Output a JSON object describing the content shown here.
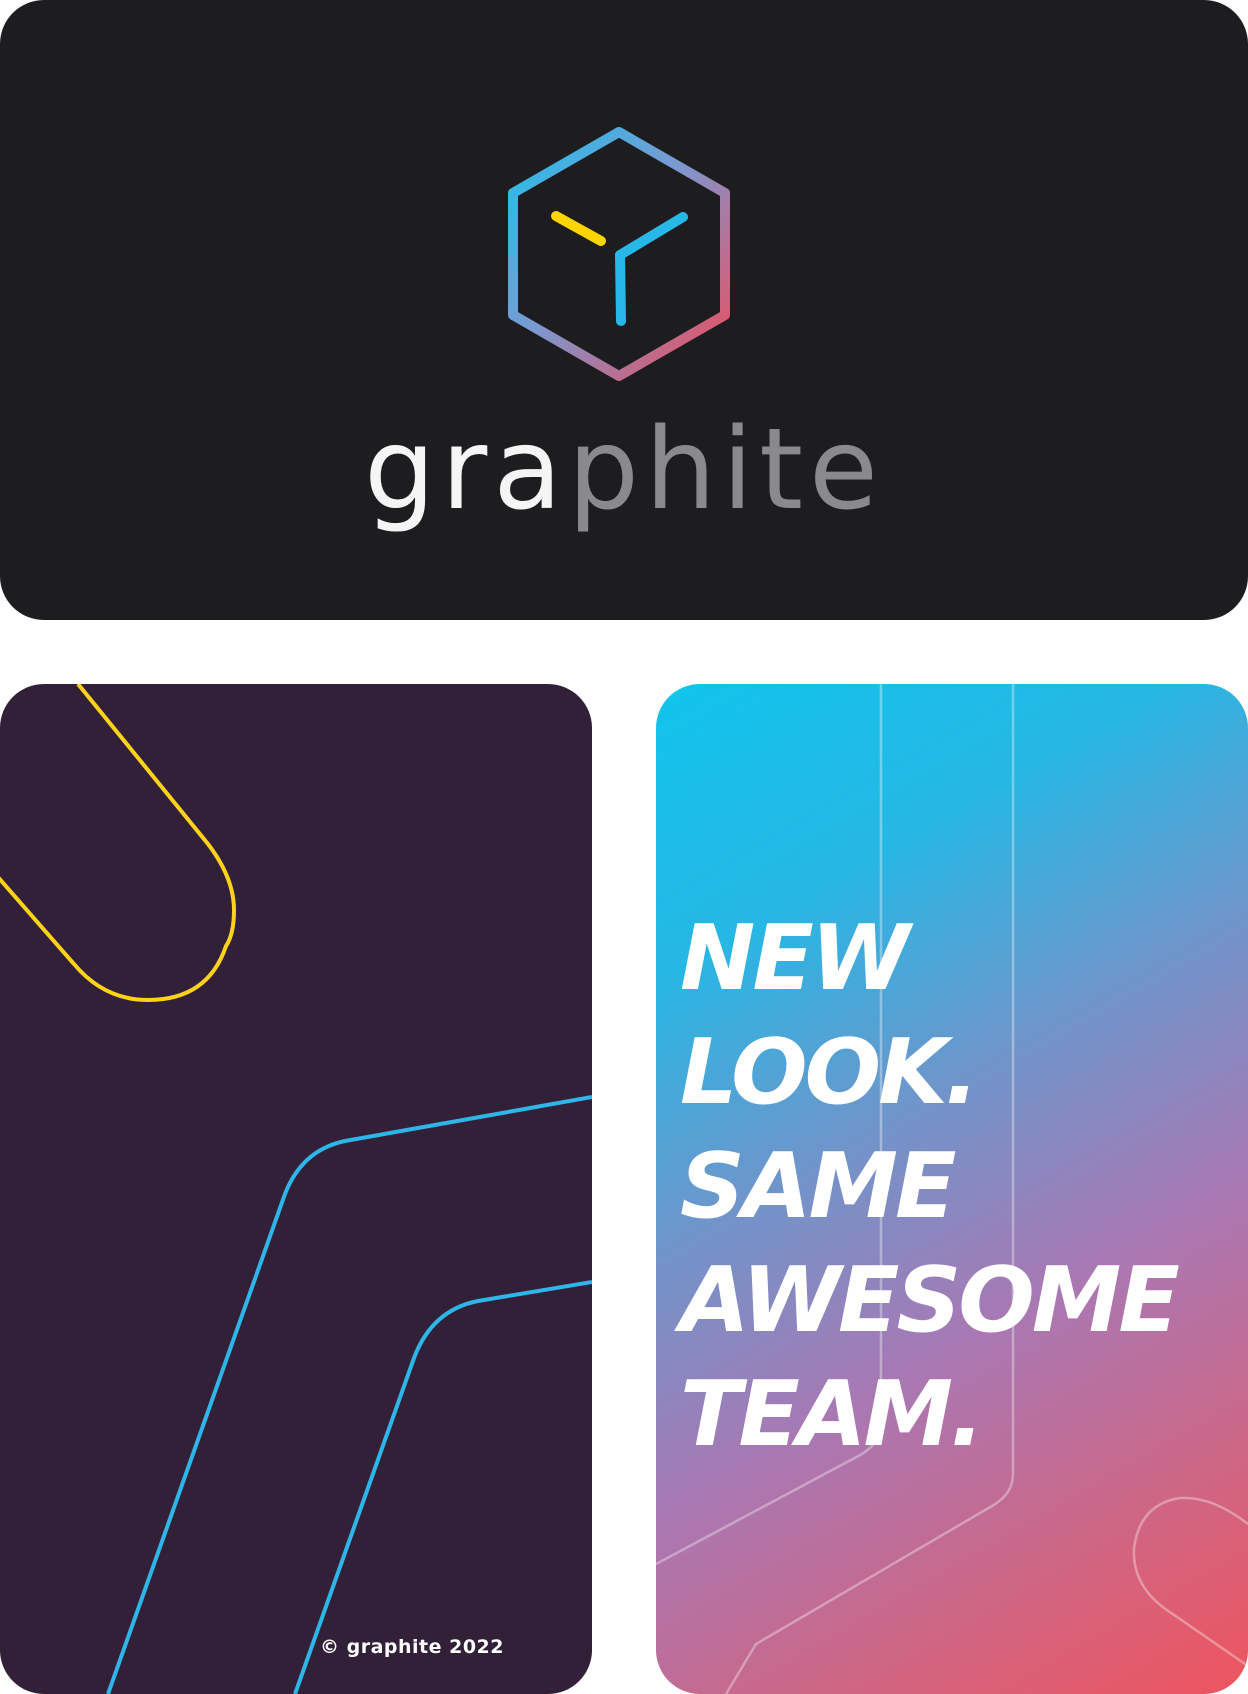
{
  "brand": {
    "wordmark_light": "gra",
    "wordmark_dark": "phite",
    "colors": {
      "cyan": "#1fb8e8",
      "yellow": "#ffd500",
      "pink": "#e8507a",
      "card_dark": "#1d1d1f",
      "card_purple": "#321f38"
    }
  },
  "pattern_card": {
    "copyright": "© graphite 2022"
  },
  "slogan_card": {
    "lines": [
      "NEW",
      "LOOK.",
      "SAME",
      "AWESOME",
      "TEAM."
    ]
  },
  "icons": {
    "logo": "hexagon-cube-logo-icon"
  }
}
